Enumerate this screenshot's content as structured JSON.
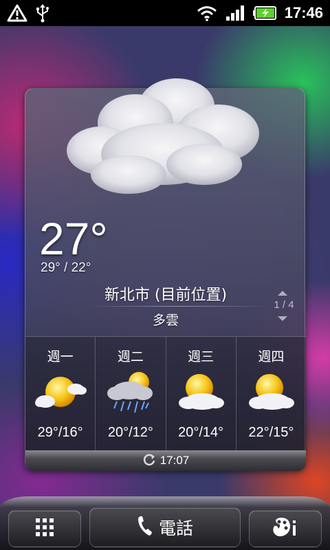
{
  "status_bar": {
    "left_icons": [
      "warning-icon",
      "usb-icon"
    ],
    "right_icons": [
      "wifi-icon",
      "signal-icon",
      "battery-charging-icon"
    ],
    "time": "17:46"
  },
  "weather": {
    "current_temp": "27°",
    "high_low": "29° / 22°",
    "city": "新北市 (目前位置)",
    "condition": "多雲",
    "page_indicator": "1 / 4",
    "forecast": [
      {
        "day": "週一",
        "icon": "partly-sunny-icon",
        "temp": "29°/16°"
      },
      {
        "day": "週二",
        "icon": "rain-sun-icon",
        "temp": "20°/12°"
      },
      {
        "day": "週三",
        "icon": "sun-cloud-icon",
        "temp": "20°/14°"
      },
      {
        "day": "週四",
        "icon": "sun-cloud-icon",
        "temp": "22°/15°"
      }
    ],
    "updated_time": "17:07"
  },
  "dock": {
    "apps_icon": "apps-grid-icon",
    "phone_label": "電話",
    "personalize_icon": "personalize-icon"
  }
}
